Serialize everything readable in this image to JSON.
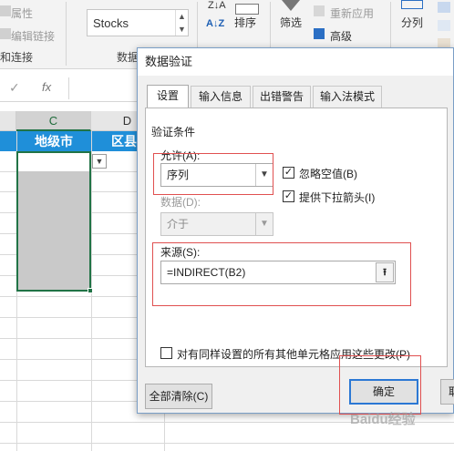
{
  "ribbon": {
    "properties": "属性",
    "edit_links": "编辑链接",
    "queries_group": "和连接",
    "stocks": "Stocks",
    "data_types_group": "数据",
    "sort": "排序",
    "filter": "筛选",
    "reapply": "重新应用",
    "advanced": "高级",
    "split": "分列",
    "sort_az": "A↓Z"
  },
  "formula_bar": {
    "fx": "fx",
    "name_arrow": "⌄",
    "cancel": "✓"
  },
  "sheet": {
    "columns": [
      "C",
      "D"
    ],
    "header_cells": [
      "地级市",
      "区县"
    ]
  },
  "dialog": {
    "title": "数据验证",
    "tabs": [
      "设置",
      "输入信息",
      "出错警告",
      "输入法模式"
    ],
    "section": "验证条件",
    "allow_label": "允许(A):",
    "allow_value": "序列",
    "ignore_blank": "忽略空值(B)",
    "dropdown": "提供下拉箭头(I)",
    "data_label": "数据(D):",
    "data_value": "介于",
    "source_label": "来源(S):",
    "source_value": "=INDIRECT(B2)",
    "apply_all": "对有同样设置的所有其他单元格应用这些更改(P)",
    "clear_all": "全部清除(C)",
    "ok": "确定",
    "cancel_partial": "取"
  },
  "watermark": "Baidu经验",
  "colors": {
    "header_blue": "#1f8fd9",
    "selection_green": "#217346",
    "highlight_red": "#e05050"
  }
}
